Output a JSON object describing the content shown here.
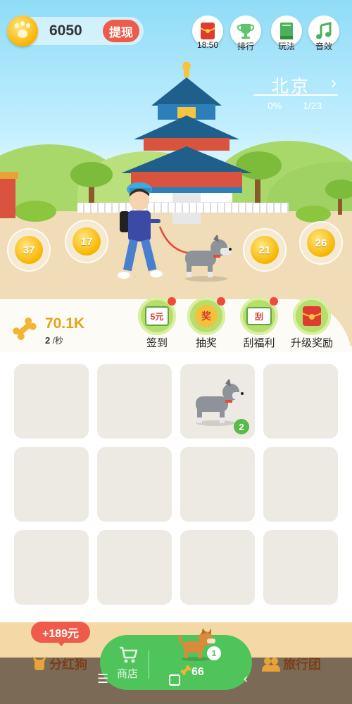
{
  "header": {
    "coin_value": "6050",
    "withdraw_label": "提现",
    "buttons": [
      {
        "icon": "red-envelope-icon",
        "label": "18:50"
      },
      {
        "icon": "trophy-icon",
        "label": "排行"
      },
      {
        "icon": "book-icon",
        "label": "玩法"
      },
      {
        "icon": "music-icon",
        "label": "音效"
      }
    ]
  },
  "city": {
    "name": "北京",
    "arrow": "›",
    "progress": "0%",
    "count": "1/23"
  },
  "bubbles": [
    "37",
    "17",
    "21",
    "26"
  ],
  "bones": {
    "total": "70.1K",
    "rate_value": "2",
    "rate_unit": "/秒"
  },
  "actions": [
    {
      "icon": "calendar-icon",
      "badge": "5元",
      "label": "签到"
    },
    {
      "icon": "lottery-icon",
      "badge": "奖",
      "label": "抽奖"
    },
    {
      "icon": "scratch-card-icon",
      "badge": "刮",
      "label": "刮福利"
    },
    {
      "icon": "gift-envelope-icon",
      "badge": "",
      "label": "升级奖励"
    }
  ],
  "grid": {
    "occupied_slot_level": "2"
  },
  "bottom": {
    "bonus": "+189元",
    "dividend_label": "分红狗",
    "shop_label": "商店",
    "buy_level": "1",
    "buy_cost": "66",
    "tour_label": "旅行团"
  },
  "colors": {
    "accent_red": "#ef5b4b",
    "green": "#4fc45a",
    "gold": "#e3a31b"
  }
}
